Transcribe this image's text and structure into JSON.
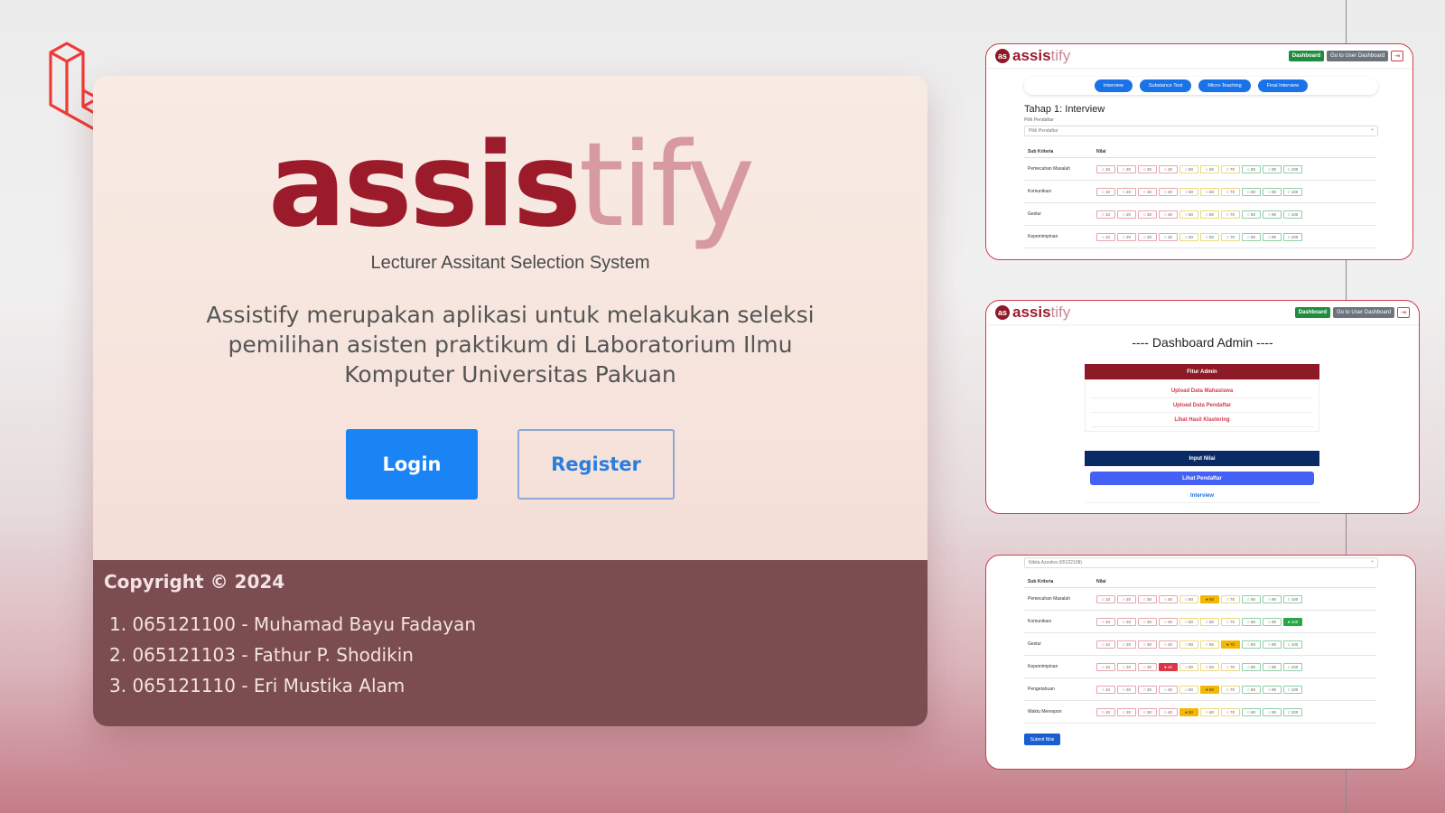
{
  "hero": {
    "brand_bold": "assis",
    "brand_light": "tify",
    "tagline": "Lecturer Assitant Selection System",
    "description": "Assistify merupakan aplikasi untuk melakukan seleksi pemilihan asisten praktikum di Laboratorium Ilmu Komputer Universitas Pakuan",
    "login_label": "Login",
    "register_label": "Register"
  },
  "footer": {
    "copyright": "Copyright © 2024",
    "members": [
      "1. 065121100 - Muhamad Bayu Fadayan",
      "2. 065121103 - Fathur P. Shodikin",
      "3. 065121110 - Eri Mustika Alam"
    ]
  },
  "mini_nav": {
    "brand_icon": "as",
    "brand_bold": "assis",
    "brand_light": "tify",
    "dashboard": "Dashboard",
    "user_dashboard": "Go to User Dashboard",
    "logout_icon": "logout-icon"
  },
  "interview_panel": {
    "steps": [
      "Interview",
      "Substance Test",
      "Micro-Teaching",
      "Final Interview"
    ],
    "title": "Tahap 1: Interview",
    "select_label": "Pilih Pendaftar",
    "select_placeholder": "Pilih Pendaftar",
    "col_sub": "Sub Kriteria",
    "col_nilai": "Nilai",
    "rows": [
      "Pemecahan Masalah",
      "Komunikasi",
      "Gestur",
      "Kepemimpinan"
    ]
  },
  "options": [
    "10",
    "20",
    "30",
    "40",
    "50",
    "60",
    "70",
    "80",
    "90",
    "100"
  ],
  "admin_panel": {
    "title": "---- Dashboard Admin ----",
    "fitur_header": "Fitur Admin",
    "fitur_color": "#8f1a27",
    "fitur_links": [
      "Upload Data Mahasiswa",
      "Upload Data Pendaftar",
      "Lihat Hasil Klastering"
    ],
    "input_header": "Input Nilai",
    "input_color": "#0a2a66",
    "lihat_button": "Lihat Pendaftar",
    "interview_link": "Interview"
  },
  "scores_panel": {
    "selected_applicant": "Nikita Azzahra (65122108)",
    "col_sub": "Sub Kriteria",
    "col_nilai": "Nilai",
    "rows": [
      {
        "label": "Pemecahan Masalah",
        "selected": "60"
      },
      {
        "label": "Komunikasi",
        "selected": "100"
      },
      {
        "label": "Gestur",
        "selected": "70"
      },
      {
        "label": "Kepemimpinan",
        "selected": "40"
      },
      {
        "label": "Pengetahuan",
        "selected": "60"
      },
      {
        "label": "Waktu Merespon",
        "selected": "50"
      }
    ],
    "submit_label": "Submit Nilai"
  },
  "colors": {
    "accent": "#9b1b2a",
    "primary": "#1a84f4",
    "footer": "#7b4d51"
  }
}
